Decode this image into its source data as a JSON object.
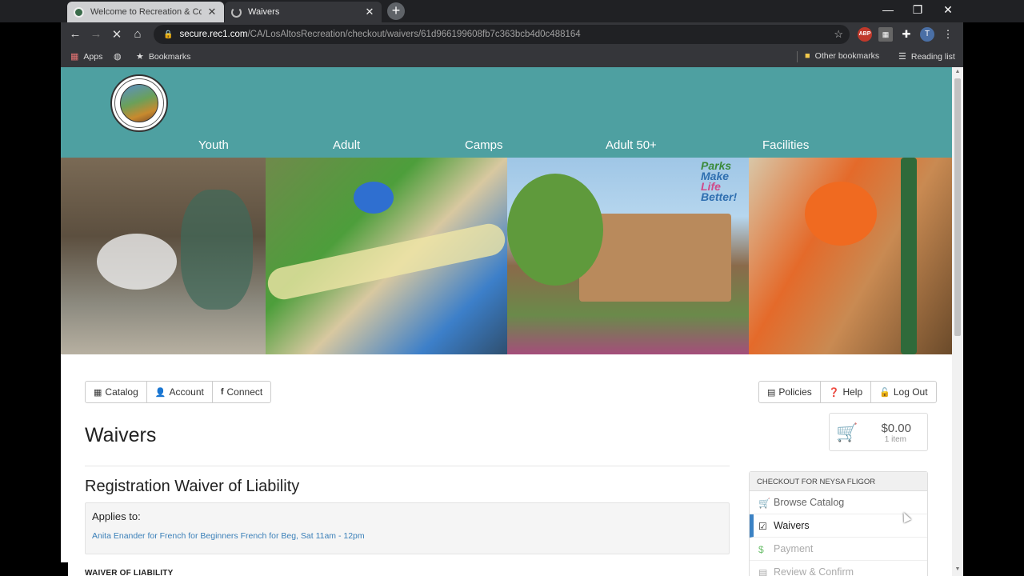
{
  "browser": {
    "tabs": [
      {
        "title": "Welcome to Recreation & Comm",
        "active": false
      },
      {
        "title": "Waivers",
        "active": true
      }
    ],
    "url": {
      "host": "secure.rec1.com",
      "path": "/CA/LosAltosRecreation/checkout/waivers/61d966199608fb7c363bcb4d0c488164"
    },
    "bookmarks": {
      "apps": "Apps",
      "bookmarks": "Bookmarks",
      "other": "Other bookmarks",
      "reading": "Reading list"
    },
    "avatar_letter": "T",
    "abp_label": "ABP"
  },
  "site": {
    "nav": [
      "Youth",
      "Adult",
      "Camps",
      "Adult 50+",
      "Facilities"
    ],
    "banner_slogan": [
      "Parks",
      "Make",
      "Life",
      "Better!"
    ]
  },
  "toolbar_left": [
    "Catalog",
    "Account",
    "Connect"
  ],
  "toolbar_right": [
    "Policies",
    "Help",
    "Log Out"
  ],
  "page_title": "Waivers",
  "cart": {
    "amount": "$0.00",
    "items": "1 item"
  },
  "waiver": {
    "title": "Registration Waiver of Liability",
    "applies_label": "Applies to:",
    "applies_link": "Anita Enander for French for Beginners French for Beg, Sat 11am - 12pm",
    "section_heading": "WAIVER OF LIABILITY"
  },
  "checkout": {
    "header": "CHECKOUT FOR NEYSA FLIGOR",
    "steps": [
      {
        "label": "Browse Catalog",
        "state": "link"
      },
      {
        "label": "Waivers",
        "state": "active"
      },
      {
        "label": "Payment",
        "state": "disabled"
      },
      {
        "label": "Review & Confirm",
        "state": "disabled"
      }
    ]
  },
  "colors": {
    "header_teal": "#4ea0a1",
    "active_step": "#3b82c4",
    "link_blue": "#3a7fb8"
  }
}
